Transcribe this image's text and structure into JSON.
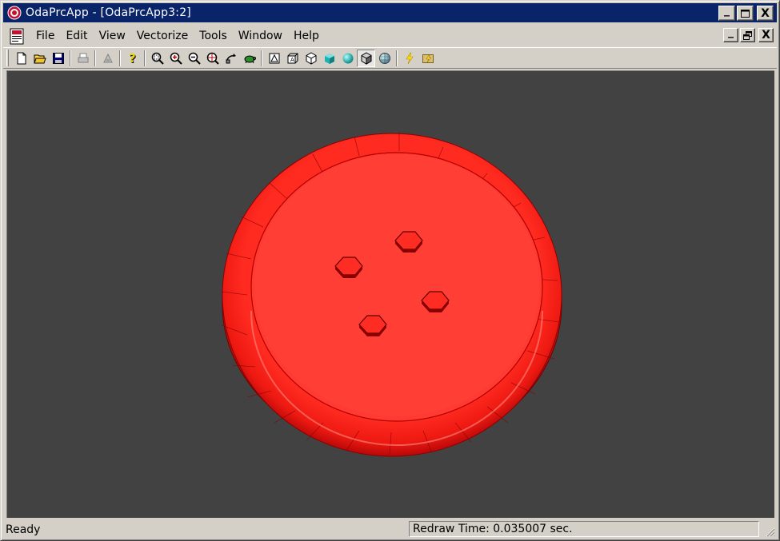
{
  "window": {
    "title": "OdaPrcApp - [OdaPrcApp3:2]"
  },
  "title_buttons": {
    "minimize": "_",
    "maximize": "□",
    "close": "X"
  },
  "mdi_buttons": {
    "minimize": "_",
    "restore": "❐",
    "close": "X"
  },
  "menu": {
    "items": [
      "File",
      "Edit",
      "View",
      "Vectorize",
      "Tools",
      "Window",
      "Help"
    ]
  },
  "toolbar": {
    "buttons": [
      {
        "icon": "new-document-icon"
      },
      {
        "icon": "open-folder-icon"
      },
      {
        "icon": "save-icon"
      },
      {
        "icon": "print-icon",
        "disabled": true
      },
      {
        "icon": "print-preview-icon",
        "disabled": true
      },
      {
        "icon": "help-icon"
      },
      {
        "icon": "zoom-window-icon"
      },
      {
        "icon": "zoom-in-icon"
      },
      {
        "icon": "zoom-out-icon"
      },
      {
        "icon": "zoom-extents-icon"
      },
      {
        "icon": "orbit-icon"
      },
      {
        "icon": "turtle-icon"
      },
      {
        "icon": "2d-wireframe-icon"
      },
      {
        "icon": "hidden-line-icon"
      },
      {
        "icon": "3d-wireframe-icon"
      },
      {
        "icon": "flat-shaded-icon"
      },
      {
        "icon": "gouraud-shaded-icon"
      },
      {
        "icon": "flat-shaded-edges-icon",
        "pressed": true
      },
      {
        "icon": "gouraud-shaded-edges-icon"
      },
      {
        "icon": "regen-icon"
      },
      {
        "icon": "regen-all-icon"
      }
    ]
  },
  "viewport": {
    "background_color": "#424242",
    "model_color": "#ff2a20"
  },
  "status": {
    "ready": "Ready",
    "redraw_time": "Redraw Time: 0.035007 sec."
  }
}
